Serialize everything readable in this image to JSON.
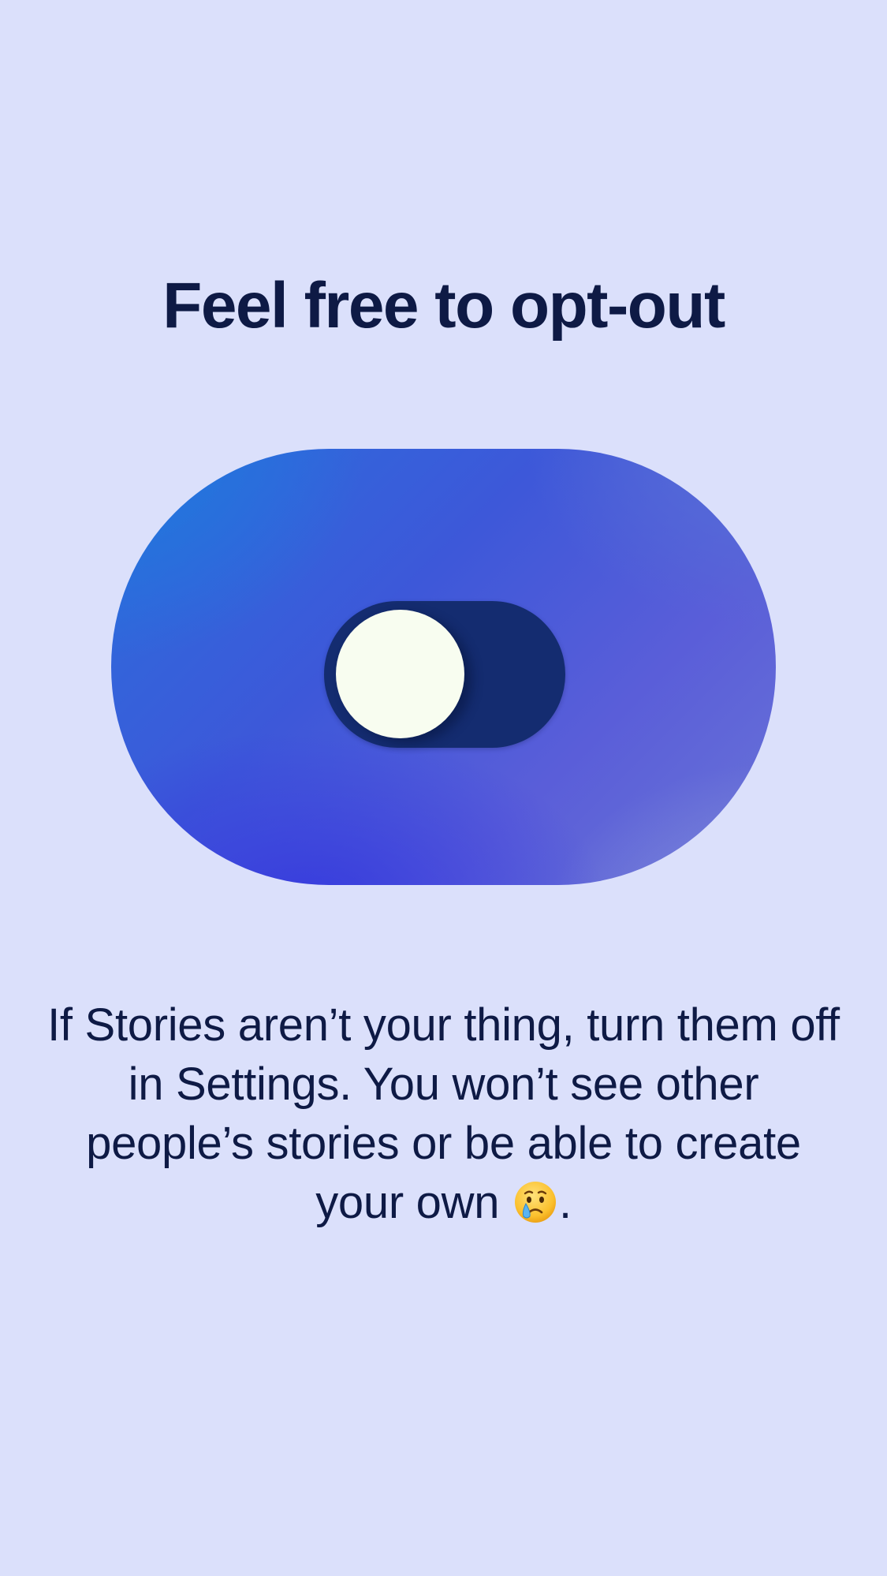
{
  "screen": {
    "title": "Feel free to opt-out",
    "description_before_emoji": "If Stories aren’t your thing, turn them off in Settings. You won’t see other people’s stories or be able to create your own ",
    "description_after_emoji": ".",
    "emoji_icon": "crying-face-icon"
  },
  "toggle": {
    "state": "off"
  },
  "colors": {
    "background": "#dbe0fb",
    "text": "#0e1a45",
    "toggle_track": "#142c70",
    "toggle_knob": "#f8fdf0",
    "illustration_start": "#1e7ade",
    "illustration_end": "#6a74d6"
  }
}
